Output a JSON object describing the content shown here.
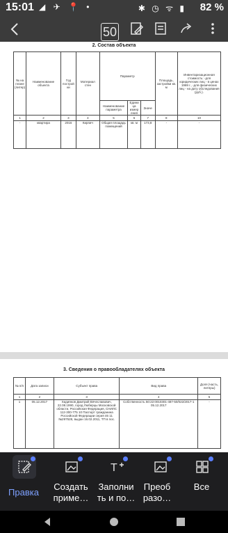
{
  "status": {
    "time": "15:01",
    "battery": "82 %"
  },
  "toolbar_top": {
    "page_indicator": "50"
  },
  "page1": {
    "section_title": "2.  Состав объекта",
    "headers": {
      "num": "№ на плане (литер)",
      "name": "Наименование объекта",
      "year": "Год построй ки",
      "material": "Материал стен",
      "param_group": "Параметр",
      "param_name": "Наименование параметра",
      "unit": "Едини ца измер ения",
      "value": "Значе",
      "area": "Площадь, застройки кв. м",
      "cost": "Инвентаризационная стоимость: -для юридических лиц - в ценах 1969 г., -для физических лиц - на дату обследования (руб.)."
    },
    "colnums": [
      "1",
      "2",
      "3",
      "4",
      "5",
      "6",
      "7",
      "8",
      "10"
    ],
    "row": {
      "num": "-",
      "name": "квартира",
      "year": "2016",
      "material": "Кирпич",
      "param": "Общая площадь помещений",
      "unit": "кв. м",
      "value": "173,8",
      "area": "-",
      "cost": "-"
    }
  },
  "page2": {
    "section_title": "3.  Сведения о правообладателях объекта",
    "headers": {
      "num": "№ п/п",
      "date": "Дата записи",
      "subject": "Субъект права",
      "right_type": "Вид права",
      "share": "Доля (часть, литеры)"
    },
    "colnums": [
      "1",
      "2",
      "3",
      "4",
      "5"
    ],
    "row": {
      "num": "1",
      "date": "05.12.2017",
      "subject": "Хидиянов Дмитрий Вячеславович, 22.08.1990, город Люберцы Московской области, Российская Федерация, СНИЛС 112-300-775 10 Паспорт гражданина Российской Федерации серия 46 11 №297528, выдан 16.02.2011, ТП в пос.",
      "right_type": "Собственность 50:22:0010301-487-50/022/2017-1 05.12.2017",
      "share": "-"
    }
  },
  "toolbar_bottom": {
    "tools": [
      {
        "label": "Правка",
        "active": true
      },
      {
        "label": "Создать приме…"
      },
      {
        "label": "Заполни ть и по…"
      },
      {
        "label": "Преоб разо…"
      },
      {
        "label": "Все"
      }
    ]
  },
  "colors": {
    "accent": "#5b7fff",
    "active_text": "#7ea1ff"
  }
}
